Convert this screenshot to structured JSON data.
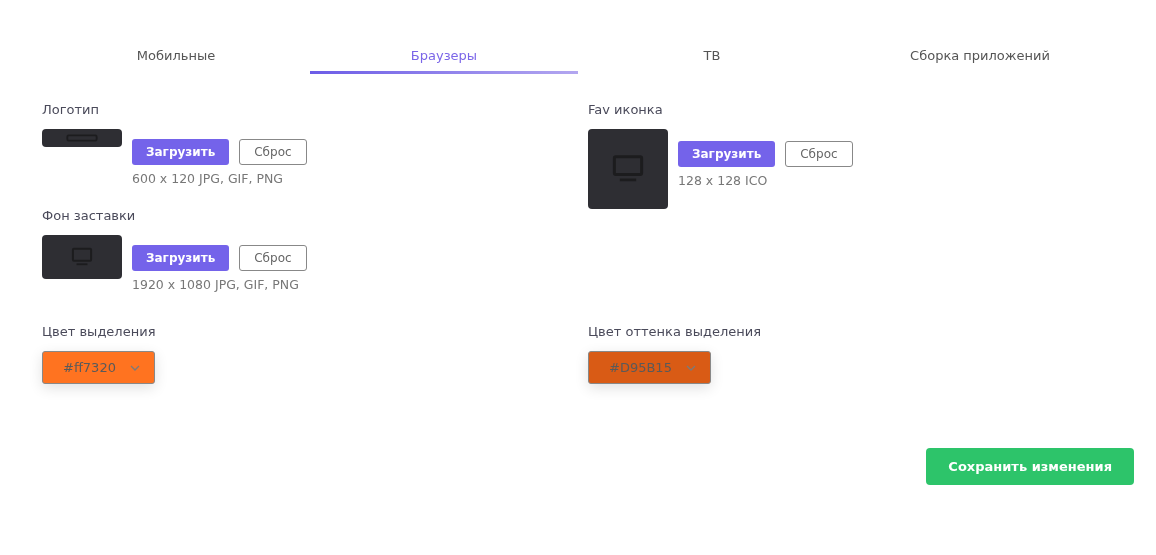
{
  "tabs": [
    {
      "label": "Мобильные",
      "selected": false
    },
    {
      "label": "Браузеры",
      "selected": true
    },
    {
      "label": "ТВ",
      "selected": false
    },
    {
      "label": "Сборка приложений",
      "selected": false
    }
  ],
  "columns": [
    {
      "uploads": [
        {
          "label": "Логотип",
          "kind": "logo",
          "upload_button": "Загрузить",
          "reset_button": "Сброс",
          "hint": "600 x 120 JPG, GIF, PNG"
        },
        {
          "label": "Фон заставки",
          "kind": "splash",
          "upload_button": "Загрузить",
          "reset_button": "Сброс",
          "hint": "1920 x 1080 JPG, GIF, PNG"
        }
      ],
      "color_picker": {
        "label": "Цвет выделения",
        "value": "#ff7320",
        "color": "#ff7320"
      }
    },
    {
      "uploads": [
        {
          "label": "Fav иконка",
          "kind": "favicon",
          "upload_button": "Загрузить",
          "reset_button": "Сброс",
          "hint": "128 x 128 ICO"
        }
      ],
      "color_picker": {
        "label": "Цвет оттенка выделения",
        "value": "#D95B15",
        "color": "#d95b15"
      }
    }
  ],
  "save_button": "Сохранить изменения"
}
